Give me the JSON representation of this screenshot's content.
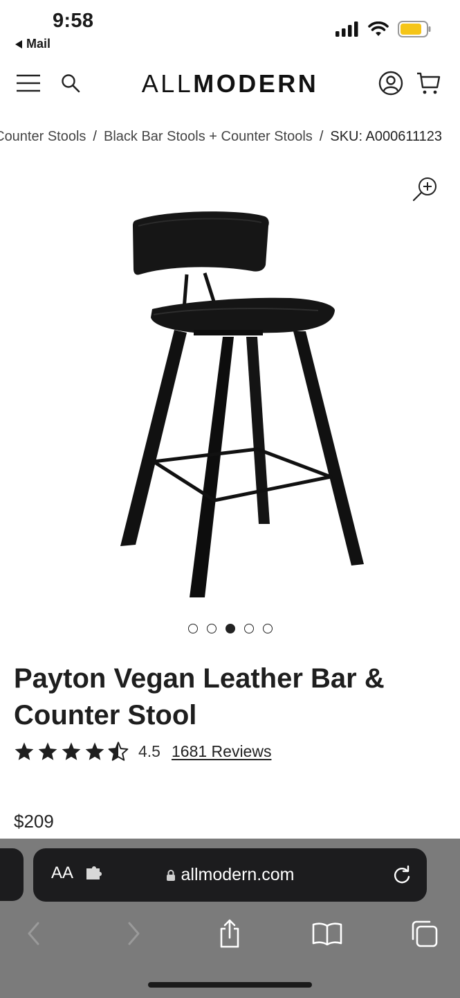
{
  "status_bar": {
    "time": "9:58",
    "back_label": "Mail",
    "battery_color": "#f5c518"
  },
  "header": {
    "logo_light": "ALL",
    "logo_bold": "MODERN",
    "icons": [
      "menu-icon",
      "search-icon",
      "account-icon",
      "cart-icon"
    ]
  },
  "breadcrumb": {
    "items": [
      "Bar + Counter Stools",
      "Black Bar Stools + Counter Stools",
      "SKU: A000611123"
    ],
    "separator": "/"
  },
  "gallery": {
    "image_count": 5,
    "active_index": 2
  },
  "product": {
    "title": "Payton Vegan Leather Bar & Counter Stool",
    "rating": 4.5,
    "rating_text": "4.5",
    "reviews_label": "1681 Reviews",
    "price": "$209"
  },
  "browser": {
    "text_size_label": "AA",
    "url": "allmodern.com",
    "toolbar": [
      "back-icon",
      "forward-icon",
      "share-icon",
      "bookmarks-icon",
      "tabs-icon"
    ]
  }
}
